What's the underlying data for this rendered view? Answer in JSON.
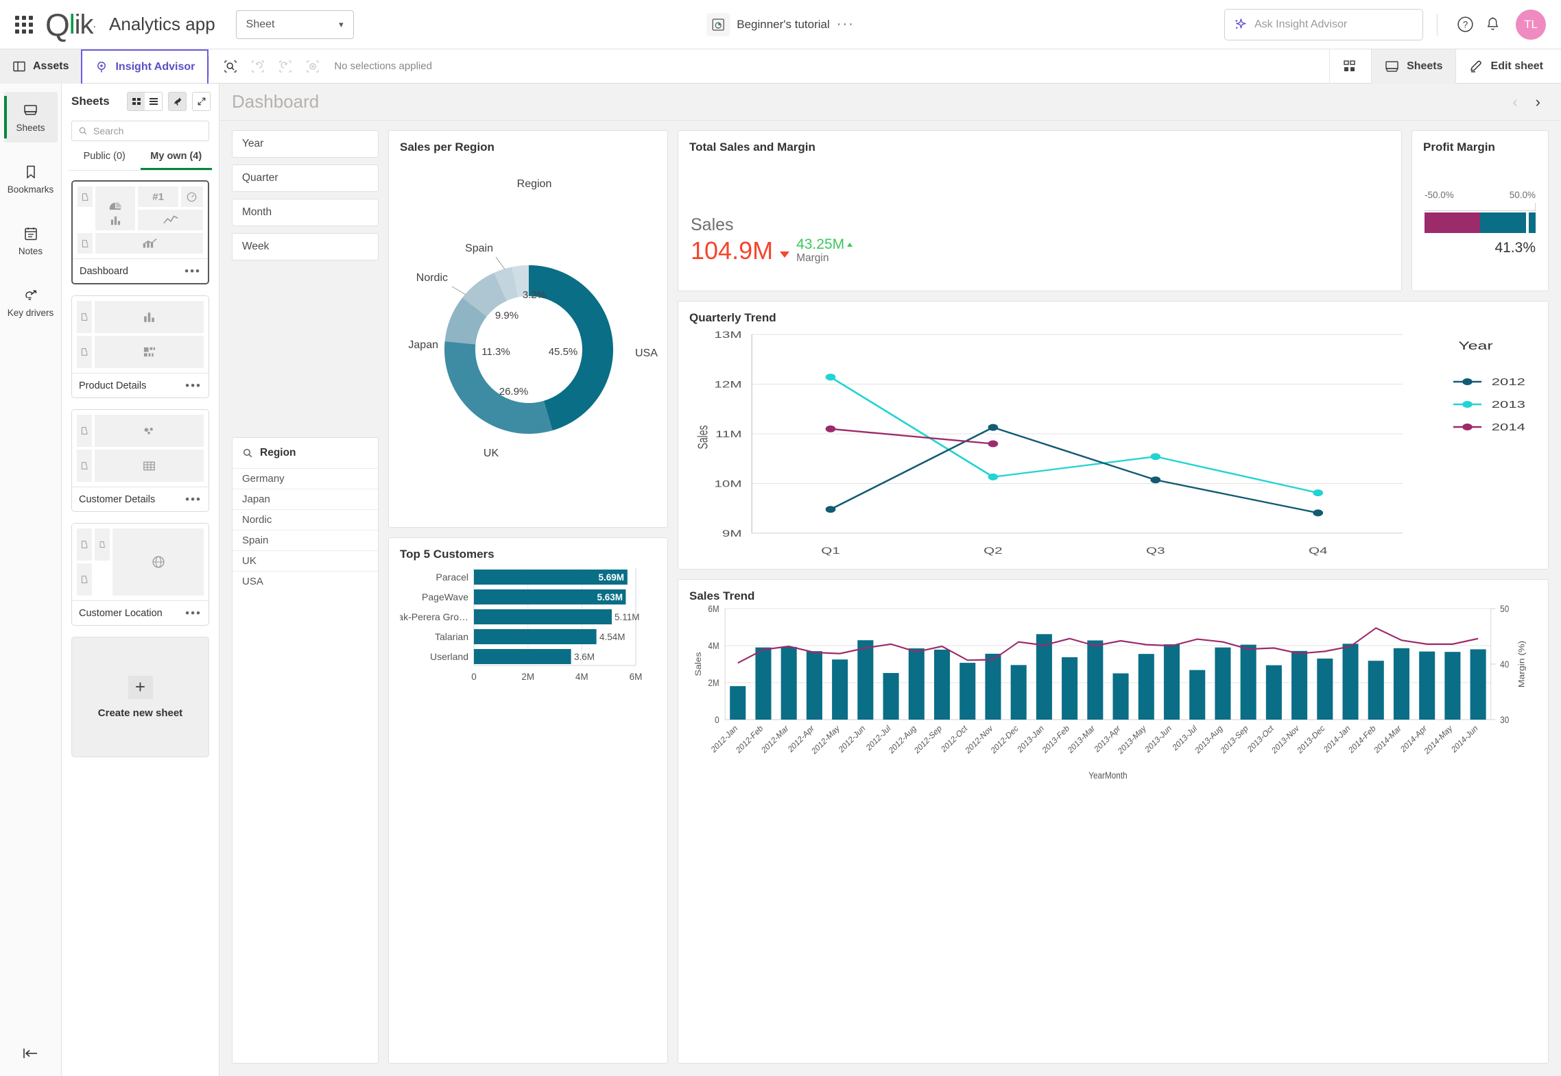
{
  "topbar": {
    "app_title": "Analytics app",
    "sheet_selector": "Sheet",
    "center_doc_title": "Beginner's tutorial",
    "center_dots": "···",
    "ask_placeholder": "Ask Insight Advisor",
    "avatar_initials": "TL",
    "logo_text_q": "Q",
    "logo_text_l": "l",
    "logo_text_i": "i",
    "logo_text_k": "k"
  },
  "toolbar": {
    "assets": "Assets",
    "insight_advisor": "Insight Advisor",
    "selection_status": "No selections applied",
    "sheets": "Sheets",
    "edit_sheet": "Edit sheet"
  },
  "rail": {
    "items": [
      {
        "label": "Sheets",
        "icon": "sheet-icon",
        "active": true
      },
      {
        "label": "Bookmarks",
        "icon": "bookmark-icon",
        "active": false
      },
      {
        "label": "Notes",
        "icon": "notes-icon",
        "active": false
      },
      {
        "label": "Key drivers",
        "icon": "key-drivers-icon",
        "active": false
      }
    ]
  },
  "sheets_panel": {
    "title": "Sheets",
    "search_placeholder": "Search",
    "tabs": [
      {
        "label": "Public (0)",
        "active": false
      },
      {
        "label": "My own (4)",
        "active": true
      }
    ],
    "sheets": [
      {
        "name": "Dashboard",
        "selected": true,
        "dots": "•••"
      },
      {
        "name": "Product Details",
        "selected": false,
        "dots": "•••"
      },
      {
        "name": "Customer Details",
        "selected": false,
        "dots": "•••"
      },
      {
        "name": "Customer Location",
        "selected": false,
        "dots": "•••"
      }
    ],
    "create_new": "Create new sheet",
    "plus": "+"
  },
  "main": {
    "dashboard_title": "Dashboard",
    "prev_arrow": "‹",
    "next_arrow": "›"
  },
  "filters": {
    "boxes": [
      "Year",
      "Quarter",
      "Month",
      "Week"
    ],
    "listbox": {
      "field": "Region",
      "values": [
        "Germany",
        "Japan",
        "Nordic",
        "Spain",
        "UK",
        "USA"
      ]
    }
  },
  "colors": {
    "teal_dark": "#0a6e87",
    "teal": "#127b91",
    "magenta": "#9c2b6b",
    "cyan": "#22d3d3",
    "navy": "#125b72",
    "red": "#f4452c",
    "green": "#3ac75b",
    "qlik_green": "#009845",
    "accent_purple": "#6a5ce0"
  },
  "chart_data": [
    {
      "id": "sales_per_region",
      "type": "pie",
      "title": "Sales per Region",
      "legend_title": "Region",
      "labels": [
        "USA",
        "UK",
        "Japan",
        "Nordic",
        "Spain"
      ],
      "values": [
        45.5,
        26.9,
        11.3,
        9.9,
        3.2
      ],
      "value_labels": [
        "45.5%",
        "26.9%",
        "11.3%",
        "9.9%",
        "3.2%"
      ],
      "slice_colors": [
        "#0a6e87",
        "#3e8ca3",
        "#8fb4c4",
        "#adc6d2",
        "#cfdde4"
      ],
      "donut": true
    },
    {
      "id": "top_5_customers",
      "type": "bar",
      "orientation": "horizontal",
      "title": "Top 5 Customers",
      "categories": [
        "Paracel",
        "PageWave",
        "Deak-Perera Gro…",
        "Talarian",
        "Userland"
      ],
      "values": [
        5.69,
        5.63,
        5.11,
        4.54,
        3.6
      ],
      "value_labels": [
        "5.69M",
        "5.63M",
        "5.11M",
        "4.54M",
        "3.6M"
      ],
      "label_inside": [
        true,
        true,
        false,
        false,
        false
      ],
      "xlim": [
        0,
        6
      ],
      "xticks": [
        0,
        2,
        4,
        6
      ],
      "xticklabels": [
        "0",
        "2M",
        "4M",
        "6M"
      ],
      "bar_color": "#0a6e87"
    },
    {
      "id": "total_sales_and_margin",
      "type": "kpi",
      "title": "Total Sales and Margin",
      "measure_label": "Sales",
      "measure_value": "104.9M",
      "measure_trend": "down",
      "secondary_value": "43.25M",
      "secondary_label": "Margin",
      "secondary_trend": "up"
    },
    {
      "id": "profit_margin",
      "type": "gauge",
      "title": "Profit Margin",
      "min_label": "-50.0%",
      "max_label": "50.0%",
      "min": -50,
      "max": 50,
      "value": 41.3,
      "value_label": "41.3%",
      "segments": [
        {
          "from": -50,
          "to": 0,
          "color": "#9c2b6b"
        },
        {
          "from": 0,
          "to": 50,
          "color": "#0a6e87"
        }
      ]
    },
    {
      "id": "quarterly_trend",
      "type": "line",
      "title": "Quarterly Trend",
      "xlabel": "",
      "ylabel": "Sales",
      "legend_title": "Year",
      "legend_position": "right",
      "categories": [
        "Q1",
        "Q2",
        "Q3",
        "Q4"
      ],
      "ylim": [
        9,
        13
      ],
      "yticks": [
        9,
        10,
        11,
        12,
        13
      ],
      "yticklabels": [
        "9M",
        "10M",
        "11M",
        "12M",
        "13M"
      ],
      "series": [
        {
          "name": "2012",
          "color": "#125b72",
          "values": [
            9.52,
            11.13,
            10.07,
            9.45
          ]
        },
        {
          "name": "2013",
          "color": "#22d3d3",
          "values": [
            12.17,
            10.16,
            10.57,
            9.84
          ]
        },
        {
          "name": "2014",
          "color": "#9c2b6b",
          "values": [
            11.1,
            10.8,
            null,
            null
          ]
        }
      ]
    },
    {
      "id": "sales_trend",
      "type": "bar",
      "title": "Sales Trend",
      "xlabel": "YearMonth",
      "ylabel": "Sales",
      "y2label": "Margin (%)",
      "ylim": [
        0,
        6
      ],
      "yticks": [
        0,
        2,
        4,
        6
      ],
      "yticklabels": [
        "0",
        "2M",
        "4M",
        "6M"
      ],
      "y2lim": [
        30,
        50
      ],
      "y2ticks": [
        30,
        40,
        50
      ],
      "y2ticklabels": [
        "30",
        "40",
        "50"
      ],
      "categories": [
        "2012-Jan",
        "2012-Feb",
        "2012-Mar",
        "2012-Apr",
        "2012-May",
        "2012-Jun",
        "2012-Jul",
        "2012-Aug",
        "2012-Sep",
        "2012-Oct",
        "2012-Nov",
        "2012-Dec",
        "2013-Jan",
        "2013-Feb",
        "2013-Mar",
        "2013-Apr",
        "2013-May",
        "2013-Jun",
        "2013-Jul",
        "2013-Aug",
        "2013-Sep",
        "2013-Oct",
        "2013-Nov",
        "2013-Dec",
        "2014-Jan",
        "2014-Feb",
        "2014-Mar",
        "2014-Apr",
        "2014-May",
        "2014-Jun"
      ],
      "series": [
        {
          "name": "Sales",
          "kind": "bar",
          "color": "#0a6e87",
          "values": [
            1.81,
            3.9,
            3.93,
            3.7,
            3.25,
            4.29,
            2.52,
            3.85,
            3.78,
            3.07,
            3.56,
            2.95,
            4.62,
            3.37,
            4.28,
            2.5,
            3.55,
            4.07,
            2.68,
            3.9,
            4.05,
            2.94,
            3.71,
            3.3,
            4.1,
            3.18,
            3.86,
            3.68,
            3.66,
            3.8
          ]
        },
        {
          "name": "Margin",
          "kind": "line",
          "color": "#9c2b6b",
          "axis": "y2",
          "values": [
            40.2,
            42.6,
            43.2,
            42.1,
            41.9,
            42.9,
            43.6,
            42.2,
            43.2,
            40.7,
            40.8,
            44.0,
            43.4,
            44.6,
            43.3,
            44.2,
            43.5,
            43.3,
            44.5,
            44.0,
            42.7,
            42.9,
            41.9,
            42.3,
            43.2,
            46.5,
            44.3,
            43.6,
            43.6,
            44.6
          ]
        }
      ]
    }
  ]
}
